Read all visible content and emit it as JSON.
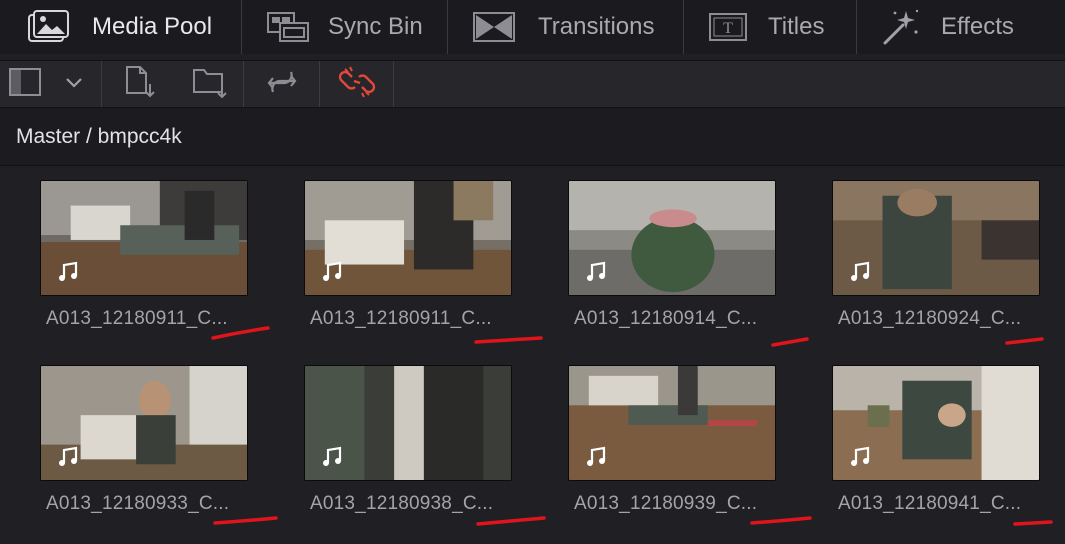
{
  "tabs": [
    {
      "label": "Media Pool",
      "icon": "media-pool-icon",
      "active": true
    },
    {
      "label": "Sync Bin",
      "icon": "sync-bin-icon",
      "active": false
    },
    {
      "label": "Transitions",
      "icon": "transitions-icon",
      "active": false
    },
    {
      "label": "Titles",
      "icon": "titles-icon",
      "active": false
    },
    {
      "label": "Effects",
      "icon": "effects-wand-icon",
      "active": false
    }
  ],
  "toolbar": {
    "buttons": [
      "panel-layout-icon",
      "chevron-down-icon",
      "import-media-icon",
      "import-folder-icon",
      "sync-icon",
      "unlink-icon"
    ],
    "accent": "#e5483b"
  },
  "breadcrumb": "Master / bmpcc4k",
  "clips": [
    {
      "name": "A013_12180911_C...",
      "icon": "music-note-icon"
    },
    {
      "name": "A013_12180911_C...",
      "icon": "music-note-icon"
    },
    {
      "name": "A013_12180914_C...",
      "icon": "music-note-icon"
    },
    {
      "name": "A013_12180924_C...",
      "icon": "music-note-icon"
    },
    {
      "name": "A013_12180933_C...",
      "icon": "music-note-icon"
    },
    {
      "name": "A013_12180938_C...",
      "icon": "music-note-icon"
    },
    {
      "name": "A013_12180939_C...",
      "icon": "music-note-icon"
    },
    {
      "name": "A013_12180941_C...",
      "icon": "music-note-icon"
    }
  ],
  "annotation_color": "#e0141c"
}
